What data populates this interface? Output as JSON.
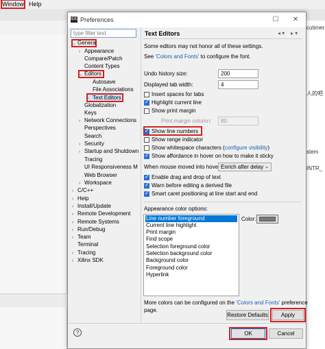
{
  "menubar": {
    "window": "Window",
    "help": "Help"
  },
  "background": {
    "right_text": [
      "cutimer.",
      "人的吧",
      "stem",
      "INTR_"
    ]
  },
  "dialog": {
    "title": "Preferences",
    "filter_placeholder": "type filter text",
    "tree": [
      {
        "label": "General",
        "arrow": "⌄"
      },
      {
        "label": "Appearance",
        "arrow": "›"
      },
      {
        "label": "Compare/Patch",
        "arrow": ""
      },
      {
        "label": "Content Types",
        "arrow": ""
      },
      {
        "label": "Editors",
        "arrow": "⌄"
      },
      {
        "label": "Autosave",
        "arrow": ""
      },
      {
        "label": "File Associations",
        "arrow": ""
      },
      {
        "label": "Text Editors",
        "arrow": "›"
      },
      {
        "label": "Globalization",
        "arrow": ""
      },
      {
        "label": "Keys",
        "arrow": ""
      },
      {
        "label": "Network Connections",
        "arrow": "›"
      },
      {
        "label": "Perspectives",
        "arrow": ""
      },
      {
        "label": "Search",
        "arrow": ""
      },
      {
        "label": "Security",
        "arrow": "›"
      },
      {
        "label": "Startup and Shutdown",
        "arrow": "›"
      },
      {
        "label": "Tracing",
        "arrow": ""
      },
      {
        "label": "UI Responsiveness M",
        "arrow": ""
      },
      {
        "label": "Web Browser",
        "arrow": ""
      },
      {
        "label": "Workspace",
        "arrow": "›"
      },
      {
        "label": "C/C++",
        "arrow": "›"
      },
      {
        "label": "Help",
        "arrow": "›"
      },
      {
        "label": "Install/Update",
        "arrow": "›"
      },
      {
        "label": "Remote Development",
        "arrow": "›"
      },
      {
        "label": "Remote Systems",
        "arrow": "›"
      },
      {
        "label": "Run/Debug",
        "arrow": "›"
      },
      {
        "label": "Team",
        "arrow": "›"
      },
      {
        "label": "Terminal",
        "arrow": ""
      },
      {
        "label": "Tracing",
        "arrow": "›"
      },
      {
        "label": "Xilinx SDK",
        "arrow": "›"
      }
    ],
    "page": {
      "title": "Text Editors",
      "note": "Some editors may not honor all of these settings.",
      "see_prefix": "See ",
      "see_link": "'Colors and Fonts'",
      "see_suffix": " to configure the font.",
      "undo_label": "Undo history size:",
      "undo_value": "200",
      "tab_label": "Displayed tab width:",
      "tab_value": "4",
      "opt_insert_spaces": "Insert spaces for tabs",
      "opt_highlight_line": "Highlight current line",
      "opt_print_margin": "Show print margin",
      "print_margin_label": "Print margin column:",
      "print_margin_value": "80",
      "opt_line_numbers": "Show line numbers",
      "opt_range_indicator": "Show range indicator",
      "opt_whitespace": "Show whitespace characters (",
      "whitespace_link": "configure visibility",
      "whitespace_close": ")",
      "opt_affordance": "Show affordance in hover on how to make it sticky",
      "hover_label": "When mouse moved into hover:",
      "hover_value": "Enrich after delay",
      "opt_drag_drop": "Enable drag and drop of text",
      "opt_warn_derived": "Warn before editing a derived file",
      "opt_smart_caret": "Smart caret positioning at line start and end",
      "appearance_label": "Appearance color options:",
      "color_options": [
        "Line number foreground",
        "Current line highlight",
        "Print margin",
        "Find scope",
        "Selection foreground color",
        "Selection background color",
        "Background color",
        "Foreground color",
        "Hyperlink"
      ],
      "color_label": "Color:",
      "more_prefix": "More colors can be configured on the ",
      "more_link": "'Colors and Fonts'",
      "more_suffix": " preference",
      "more_line2": "page.",
      "restore_defaults": "Restore Defaults",
      "apply": "Apply"
    },
    "ok": "OK",
    "cancel": "Cancel"
  },
  "colors": {
    "highlight_red": "#d42020",
    "selection_blue": "#0078d7",
    "link": "#1a5fb4"
  }
}
